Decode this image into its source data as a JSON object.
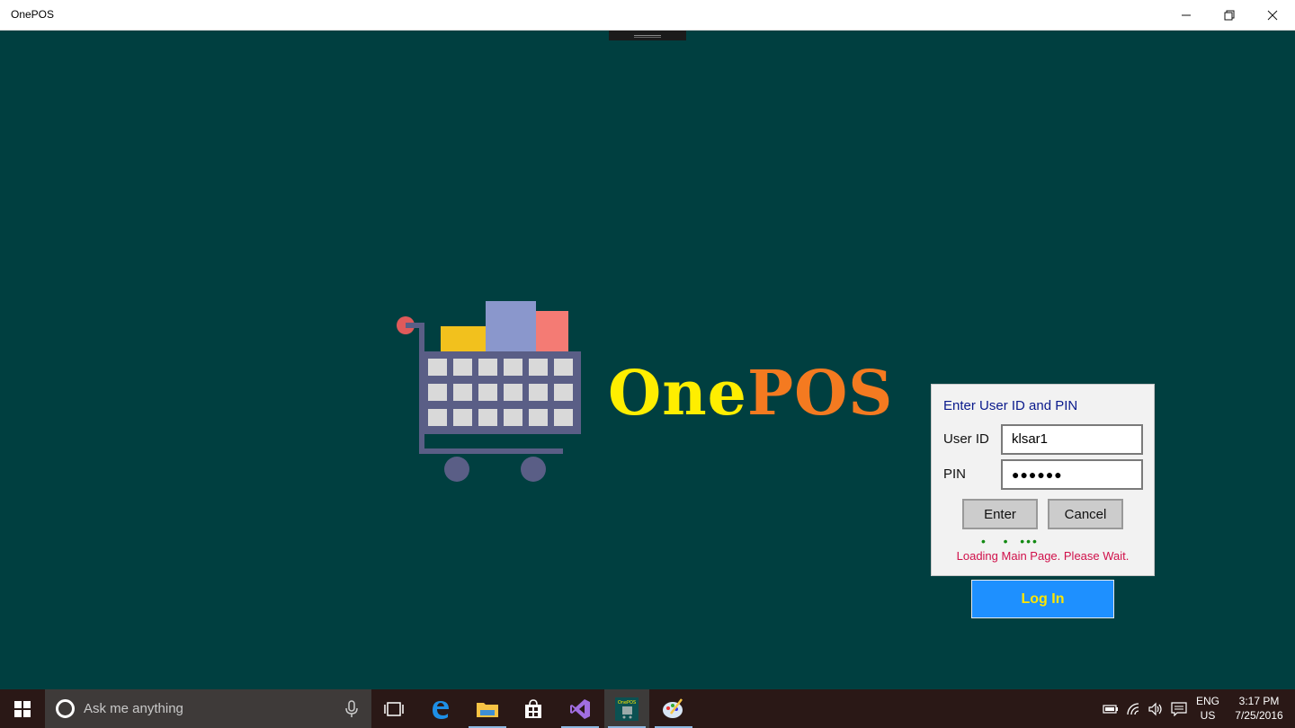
{
  "window": {
    "title": "OnePOS",
    "minimize_glyph": "—",
    "maximize_glyph": "❐",
    "close_glyph": "✕"
  },
  "logo": {
    "text_one": "One",
    "text_pos": "POS",
    "colors": {
      "one": "#ffee00",
      "pos": "#f47a20"
    }
  },
  "login_panel": {
    "title": "Enter User ID and PIN",
    "user_id_label": "User ID",
    "user_id_value": "klsar1",
    "pin_label": "PIN",
    "pin_value": "●●●●●●",
    "enter_label": "Enter",
    "cancel_label": "Cancel",
    "progress_dots": "•   •  •••",
    "status_message": "Loading Main Page. Please Wait."
  },
  "login_button": {
    "label": "Log In"
  },
  "taskbar": {
    "search_placeholder": "Ask me anything",
    "pinned_apps": [
      "task-view",
      "edge",
      "file-explorer",
      "store",
      "visual-studio",
      "onepos",
      "paint"
    ],
    "active_app": "onepos",
    "language_line1": "ENG",
    "language_line2": "US",
    "time": "3:17 PM",
    "date": "7/25/2016",
    "onepos_icon_label": "OnePOS"
  },
  "colors": {
    "background": "#003f40",
    "login_button": "#1e90ff",
    "login_button_text": "#ffe600",
    "status_text": "#d0104a",
    "panel_title": "#0a1a8c"
  }
}
